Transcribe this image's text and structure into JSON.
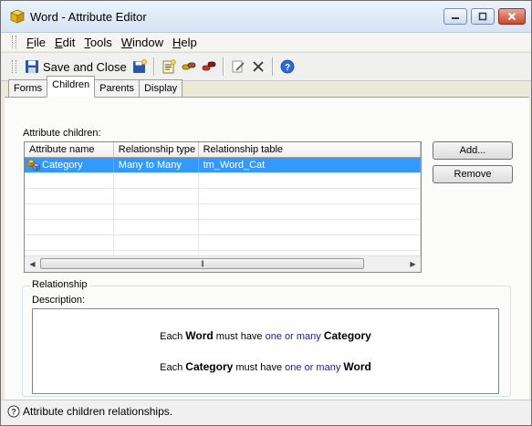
{
  "window": {
    "title": "Word - Attribute Editor",
    "minimize": "—",
    "maximize": "□",
    "close": "✕"
  },
  "menu": {
    "items": [
      {
        "key": "F",
        "rest": "ile"
      },
      {
        "key": "E",
        "rest": "dit"
      },
      {
        "key": "T",
        "rest": "ools"
      },
      {
        "key": "W",
        "rest": "indow"
      },
      {
        "key": "H",
        "rest": "elp"
      }
    ]
  },
  "toolbar": {
    "save_close_label": "Save and Close"
  },
  "tabs": [
    {
      "label": "Forms",
      "active": false
    },
    {
      "label": "Children",
      "active": true
    },
    {
      "label": "Parents",
      "active": false
    },
    {
      "label": "Display",
      "active": false
    }
  ],
  "children": {
    "section_label": "Attribute children:",
    "columns": [
      "Attribute name",
      "Relationship type",
      "Relationship table"
    ],
    "rows": [
      {
        "name": "Category",
        "type": "Many to Many",
        "table": "tm_Word_Cat",
        "selected": true
      }
    ],
    "empty_rows": 6,
    "scroll_left": "◀",
    "scroll_right": "▶",
    "scroll_thumb_grip": "|||"
  },
  "buttons": {
    "add": "Add...",
    "remove": "Remove"
  },
  "relationship": {
    "group_title": "Relationship",
    "description_label": "Description:",
    "line1": {
      "p1": "Each ",
      "b1": "Word",
      "p2": " must have ",
      "blue": "one or many",
      "p3": " ",
      "b2": "Category"
    },
    "line2": {
      "p1": "Each ",
      "b1": "Category",
      "p2": " must have ",
      "blue": "one or many",
      "p3": " ",
      "b2": "Word"
    }
  },
  "status": {
    "text": "Attribute children relationships."
  },
  "colors": {
    "selection": "#3399ff",
    "link_blue": "#1a1aa0"
  }
}
